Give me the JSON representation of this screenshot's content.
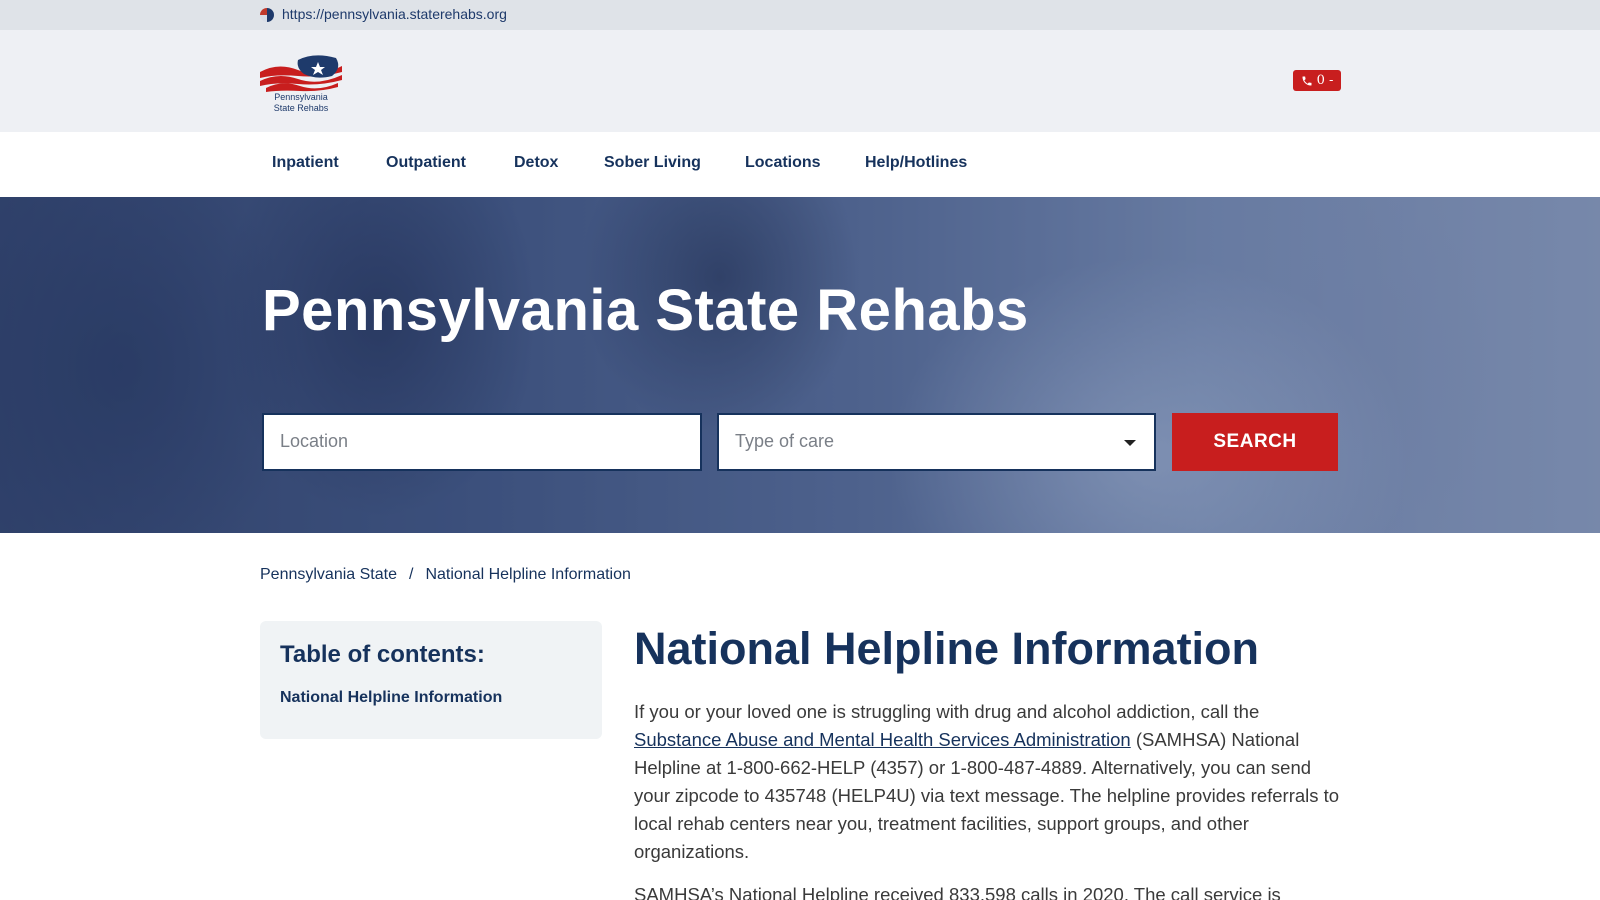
{
  "browser": {
    "url": "https://pennsylvania.staterehabs.org"
  },
  "header": {
    "logo_text_line1": "Pennsylvania",
    "logo_text_line2": "State Rehabs",
    "phone_badge": "0 -"
  },
  "nav": {
    "items": [
      {
        "label": "Inpatient"
      },
      {
        "label": "Outpatient"
      },
      {
        "label": "Detox"
      },
      {
        "label": "Sober Living"
      },
      {
        "label": "Locations"
      },
      {
        "label": "Help/Hotlines"
      }
    ]
  },
  "hero": {
    "title": "Pennsylvania State Rehabs",
    "location_placeholder": "Location",
    "care_placeholder": "Type of care",
    "search_label": "SEARCH"
  },
  "breadcrumb": {
    "items": [
      "Pennsylvania State",
      "National Helpline Information"
    ],
    "separator": "/"
  },
  "toc": {
    "title": "Table of contents:",
    "items": [
      "National Helpline Information"
    ]
  },
  "article": {
    "title": "National Helpline Information",
    "p1_before": "If you or your loved one is struggling with drug and alcohol addiction, call the ",
    "p1_link": "Substance Abuse and Mental Health Services Administration",
    "p1_after": " (SAMHSA) National Helpline at 1-800-662-HELP (4357) or 1-800-487-4889. Alternatively, you can send your zipcode to 435748 (HELP4U) via text message. The helpline provides referrals to local rehab centers near you, treatment facilities, support groups, and other organizations.",
    "p2": "SAMHSA’s National Helpline received 833,598 calls in 2020. The call service is"
  },
  "colors": {
    "brand_navy": "#16325c",
    "accent_red": "#c81e1e",
    "header_bg": "#eef0f4"
  }
}
